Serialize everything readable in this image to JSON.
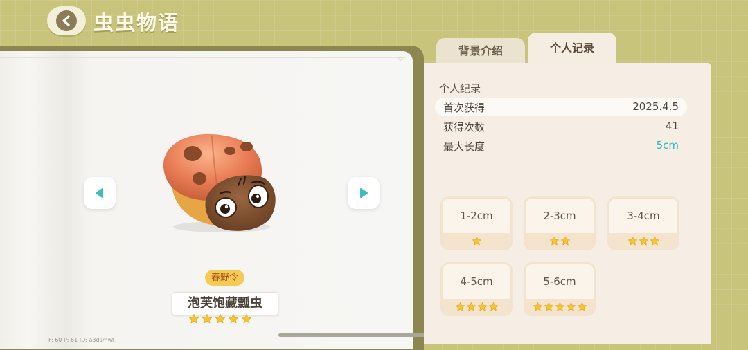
{
  "header": {
    "title": "虫虫物语"
  },
  "tabs": [
    {
      "label": "背景介绍",
      "active": false
    },
    {
      "label": "个人记录",
      "active": true
    }
  ],
  "record": {
    "section_title": "个人纪录",
    "rows": [
      {
        "label": "首次获得",
        "value": "2025.4.5"
      },
      {
        "label": "获得次数",
        "value": "41"
      },
      {
        "label": "最大长度",
        "value": "5cm"
      }
    ]
  },
  "size_grades": [
    {
      "range": "1-2cm",
      "stars": 1
    },
    {
      "range": "2-3cm",
      "stars": 2
    },
    {
      "range": "3-4cm",
      "stars": 3
    },
    {
      "range": "4-5cm",
      "stars": 4
    },
    {
      "range": "5-6cm",
      "stars": 5
    }
  ],
  "bug": {
    "season": "春野令",
    "name": "泡芙饱藏瓢虫",
    "stars": 5
  },
  "debug": "F: 60   P: 61   ID: a3dsmwt",
  "colors": {
    "background": "#c9c47c",
    "panel": "#f6eee4",
    "star": "#f7c531",
    "highlight_value": "#2bb8c0",
    "nav_arrow": "#3bbdb9"
  },
  "icons": {
    "back": "chevron-left-icon",
    "prev": "triangle-left-icon",
    "next": "triangle-right-icon",
    "star": "star-icon"
  }
}
